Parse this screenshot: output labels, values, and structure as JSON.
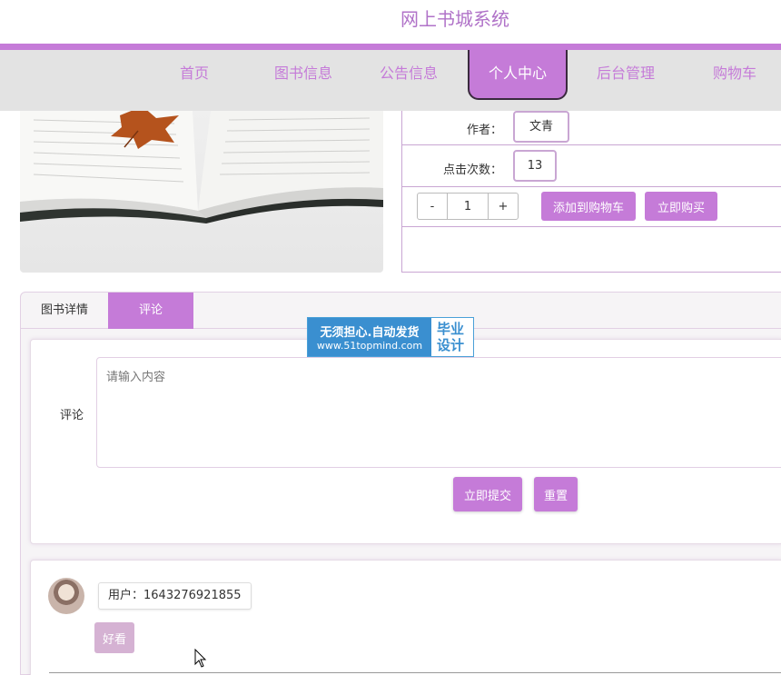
{
  "site": {
    "title": "网上书城系统"
  },
  "nav": {
    "items": [
      {
        "label": "首页"
      },
      {
        "label": "图书信息"
      },
      {
        "label": "公告信息"
      },
      {
        "label": "个人中心"
      },
      {
        "label": "后台管理"
      },
      {
        "label": "购物车"
      }
    ],
    "active_index": 3
  },
  "book": {
    "author_label": "作者：",
    "author_value": "文青",
    "clicks_label": "点击次数：",
    "clicks_value": "13",
    "qty_minus": "-",
    "qty_value": "1",
    "qty_plus": "+",
    "add_cart_label": "添加到购物车",
    "buy_now_label": "立即购买"
  },
  "tabs": [
    {
      "label": "图书详情"
    },
    {
      "label": "评论"
    }
  ],
  "comment_form": {
    "label": "评论",
    "placeholder": "请输入内容",
    "submit_label": "立即提交",
    "reset_label": "重置"
  },
  "comments": [
    {
      "user": "用户：1643276921855",
      "content": "好看"
    }
  ],
  "watermark": {
    "line1": "无须担心.自动发货",
    "line2": "www.51topmind.com",
    "right1": "毕业",
    "right2": "设计"
  },
  "colors": {
    "accent": "#c57bd8",
    "nav_bg": "#e3e3e3",
    "title": "#b072c8"
  }
}
